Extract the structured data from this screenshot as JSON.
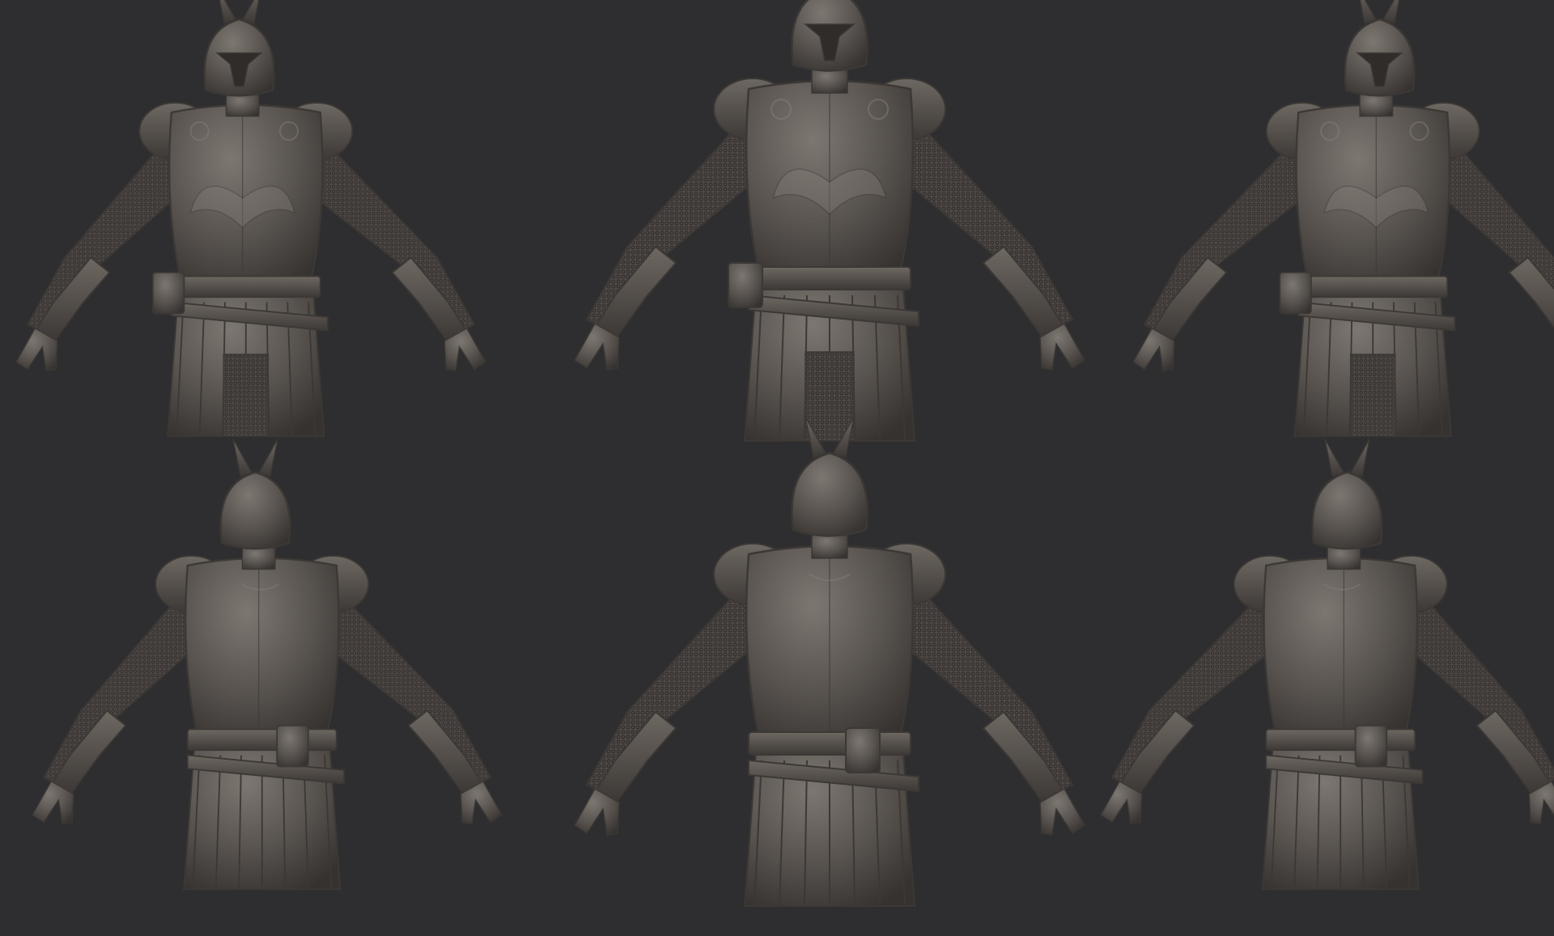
{
  "scene": {
    "background": "#2e2e30",
    "clay_color": "#58534f",
    "clay_dark": "#3c3835",
    "clay_light": "#86807a",
    "clay_shadow": "#302c2a",
    "figures": [
      {
        "name": "figure-front-left",
        "view": "front",
        "turn": -0.45
      },
      {
        "name": "figure-front-center",
        "view": "front",
        "turn": 0
      },
      {
        "name": "figure-front-right",
        "view": "front",
        "turn": 0.45
      },
      {
        "name": "figure-back-left",
        "view": "back",
        "turn": -0.45
      },
      {
        "name": "figure-back-center",
        "view": "back",
        "turn": 0
      },
      {
        "name": "figure-back-right",
        "view": "back",
        "turn": 0.45
      }
    ]
  }
}
